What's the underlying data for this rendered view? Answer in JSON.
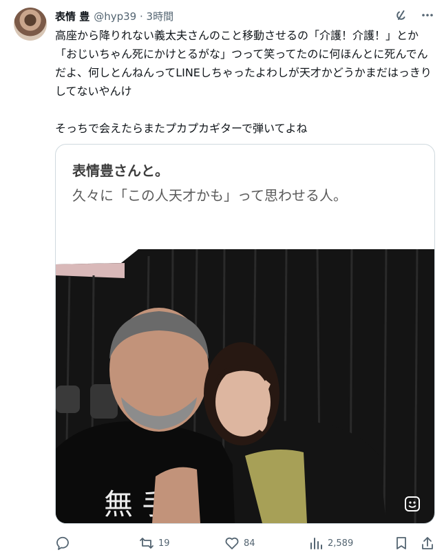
{
  "tweet": {
    "author_name": "表情 豊",
    "handle_time": "@hyp39 · 3時間",
    "text": "高座から降りれない義太夫さんのこと移動させるの「介護！介護！」とか「おじいちゃん死にかけとるがな」つって笑ってたのに何ほんとに死んでんだよ、何しとんねんってLINEしちゃったよわしが天才かどうかまだはっきりしてないやんけ\n\nそっちで会えたらまたプカプカギターで弾いてよね"
  },
  "card": {
    "title": "表情豊さんと。",
    "subtitle": "久々に「この人天才かも」って思わせる人。",
    "shirt_text": "無 手"
  },
  "actions": {
    "reply_count": "",
    "retweet_count": "19",
    "like_count": "84",
    "view_count": "2,589"
  },
  "icons": {
    "header": [
      "grok-icon",
      "more-icon"
    ],
    "actions": [
      "reply-icon",
      "retweet-icon",
      "like-icon",
      "views-icon",
      "bookmark-icon",
      "share-icon"
    ]
  },
  "colors": {
    "text": "#0f1419",
    "muted": "#536471",
    "border": "#cfd9de"
  }
}
